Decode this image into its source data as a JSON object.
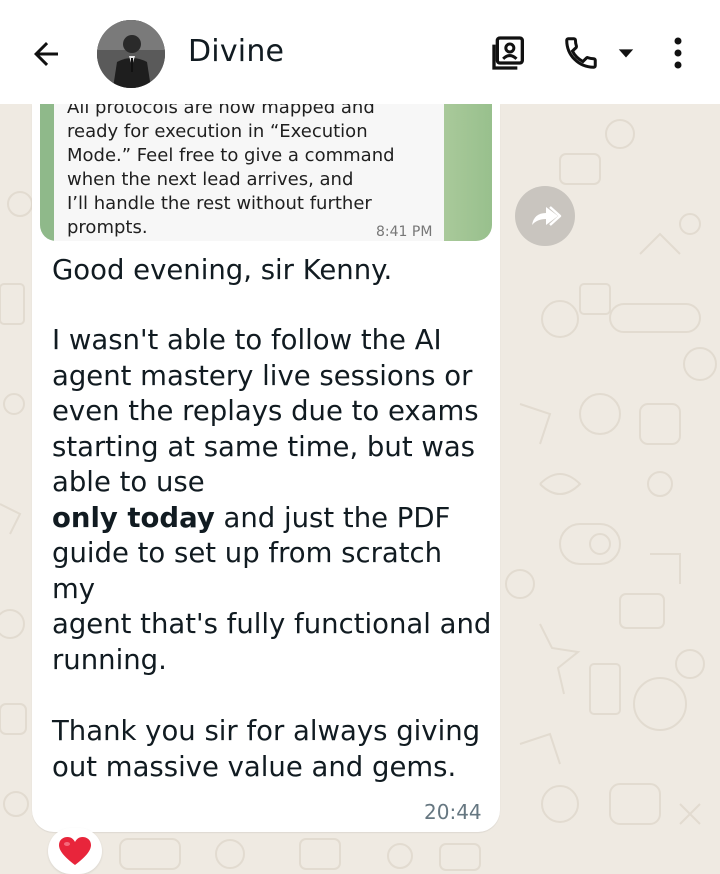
{
  "header": {
    "contact_name": "Divine",
    "back_icon": "arrow-left-icon",
    "contact_card_icon": "contact-card-icon",
    "call_icon": "phone-icon",
    "call_dropdown_icon": "caret-down-icon",
    "menu_icon": "more-vertical-icon"
  },
  "quoted_message": {
    "lines": [
      "All protocols are now mapped and",
      "ready for execution in “Execution",
      "Mode.” Feel free to give a command",
      "when the next lead arrives, and",
      "I’ll handle the rest without further",
      "prompts."
    ],
    "time": "8:41 PM"
  },
  "message": {
    "greeting": "Good evening, sir Kenny.",
    "para1_lines": [
      "I wasn't able to follow the AI",
      "agent mastery live sessions or",
      "even the replays due to exams",
      "starting at same time, but was",
      "able to use"
    ],
    "bold_phrase": "only today",
    "para2_rest_first": " and just the PDF",
    "para2_lines": [
      "guide to set up from scratch my",
      "agent that's fully functional and",
      "running."
    ],
    "thanks_lines": [
      "Thank you sir for always giving",
      "out massive value and gems."
    ],
    "time": "20:44"
  },
  "reaction": {
    "emoji": "❤️"
  },
  "colors": {
    "wallpaper": "#efeae2",
    "bubble": "#ffffff",
    "header": "#ffffff",
    "quote_accent": "#8fb98a"
  }
}
